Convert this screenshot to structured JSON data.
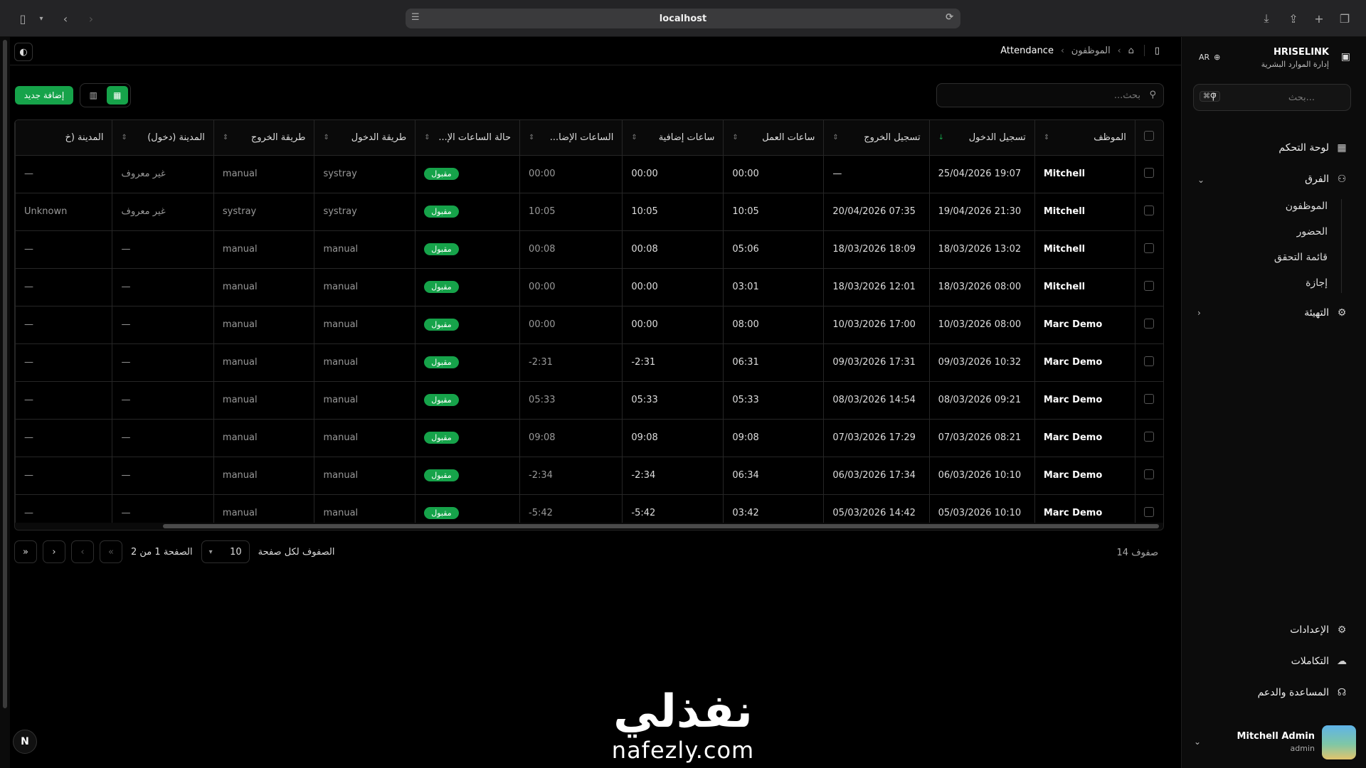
{
  "browser": {
    "url": "localhost"
  },
  "breadcrumb": {
    "current": "Attendance",
    "parent": "الموظفون"
  },
  "toolbar": {
    "search_placeholder": "بحث...",
    "add_label": "إضافة جديد"
  },
  "table": {
    "headers": [
      "الموظف",
      "تسجيل الدخول",
      "تسجيل الخروج",
      "ساعات العمل",
      "ساعات إضافية",
      "الساعات الإضا...",
      "حالة الساعات الإ...",
      "طريقة الدخول",
      "طريقة الخروج",
      "المدينة (دخول)",
      "المدينة (خ"
    ],
    "rows": [
      {
        "employee": "Mitchell",
        "check_in": "19:07 25/04/2026",
        "check_out": "—",
        "worked": "00:00",
        "overtime": "00:00",
        "extra": "00:00",
        "status": "مقبول",
        "in_mode": "systray",
        "out_mode": "manual",
        "city_in": "غير معروف",
        "city_out": "—"
      },
      {
        "employee": "Mitchell",
        "check_in": "21:30 19/04/2026",
        "check_out": "07:35 20/04/2026",
        "worked": "10:05",
        "overtime": "10:05",
        "extra": "10:05",
        "status": "مقبول",
        "in_mode": "systray",
        "out_mode": "systray",
        "city_in": "غير معروف",
        "city_out": "Unknown"
      },
      {
        "employee": "Mitchell",
        "check_in": "13:02 18/03/2026",
        "check_out": "18:09 18/03/2026",
        "worked": "05:06",
        "overtime": "00:08",
        "extra": "00:08",
        "status": "مقبول",
        "in_mode": "manual",
        "out_mode": "manual",
        "city_in": "—",
        "city_out": "—"
      },
      {
        "employee": "Mitchell",
        "check_in": "08:00 18/03/2026",
        "check_out": "12:01 18/03/2026",
        "worked": "03:01",
        "overtime": "00:00",
        "extra": "00:00",
        "status": "مقبول",
        "in_mode": "manual",
        "out_mode": "manual",
        "city_in": "—",
        "city_out": "—"
      },
      {
        "employee": "Marc Demo",
        "check_in": "08:00 10/03/2026",
        "check_out": "17:00 10/03/2026",
        "worked": "08:00",
        "overtime": "00:00",
        "extra": "00:00",
        "status": "مقبول",
        "in_mode": "manual",
        "out_mode": "manual",
        "city_in": "—",
        "city_out": "—"
      },
      {
        "employee": "Marc Demo",
        "check_in": "10:32 09/03/2026",
        "check_out": "17:31 09/03/2026",
        "worked": "06:31",
        "overtime": "2:31-",
        "extra": "2:31-",
        "status": "مقبول",
        "in_mode": "manual",
        "out_mode": "manual",
        "city_in": "—",
        "city_out": "—"
      },
      {
        "employee": "Marc Demo",
        "check_in": "09:21 08/03/2026",
        "check_out": "14:54 08/03/2026",
        "worked": "05:33",
        "overtime": "05:33",
        "extra": "05:33",
        "status": "مقبول",
        "in_mode": "manual",
        "out_mode": "manual",
        "city_in": "—",
        "city_out": "—"
      },
      {
        "employee": "Marc Demo",
        "check_in": "08:21 07/03/2026",
        "check_out": "17:29 07/03/2026",
        "worked": "09:08",
        "overtime": "09:08",
        "extra": "09:08",
        "status": "مقبول",
        "in_mode": "manual",
        "out_mode": "manual",
        "city_in": "—",
        "city_out": "—"
      },
      {
        "employee": "Marc Demo",
        "check_in": "10:10 06/03/2026",
        "check_out": "17:34 06/03/2026",
        "worked": "06:34",
        "overtime": "2:34-",
        "extra": "2:34-",
        "status": "مقبول",
        "in_mode": "manual",
        "out_mode": "manual",
        "city_in": "—",
        "city_out": "—"
      },
      {
        "employee": "Marc Demo",
        "check_in": "10:10 05/03/2026",
        "check_out": "14:42 05/03/2026",
        "worked": "03:42",
        "overtime": "5:42-",
        "extra": "5:42-",
        "status": "مقبول",
        "in_mode": "manual",
        "out_mode": "manual",
        "city_in": "—",
        "city_out": "—"
      }
    ]
  },
  "footer": {
    "rows_count": "14 صفوف",
    "rows_per_page_label": "الصفوف لكل صفحة",
    "rows_per_page": "10",
    "page_label": "الصفحة 1 من 2"
  },
  "watermark": {
    "arabic": "نفذلي",
    "latin": "nafezly.com"
  },
  "sidebar": {
    "app_name": "HRISELINK",
    "app_sub": "إدارة الموارد البشرية",
    "lang": "AR",
    "search_placeholder": "بحث...",
    "search_kbd": "⌘ F",
    "nav": {
      "dashboard": "لوحة التحكم",
      "teams": "الفرق",
      "employees": "الموظفون",
      "attendance": "الحضور",
      "checklist": "قائمة التحقق",
      "leave": "إجازة",
      "setup": "التهيئة",
      "settings": "الإعدادات",
      "integrations": "التكاملات",
      "help": "المساعدة والدعم"
    },
    "user": {
      "name": "Mitchell Admin",
      "role": "admin"
    }
  },
  "colors": {
    "accent": "#16a34a",
    "background": "#000000",
    "sidebar_bg": "#0c0c0c"
  }
}
